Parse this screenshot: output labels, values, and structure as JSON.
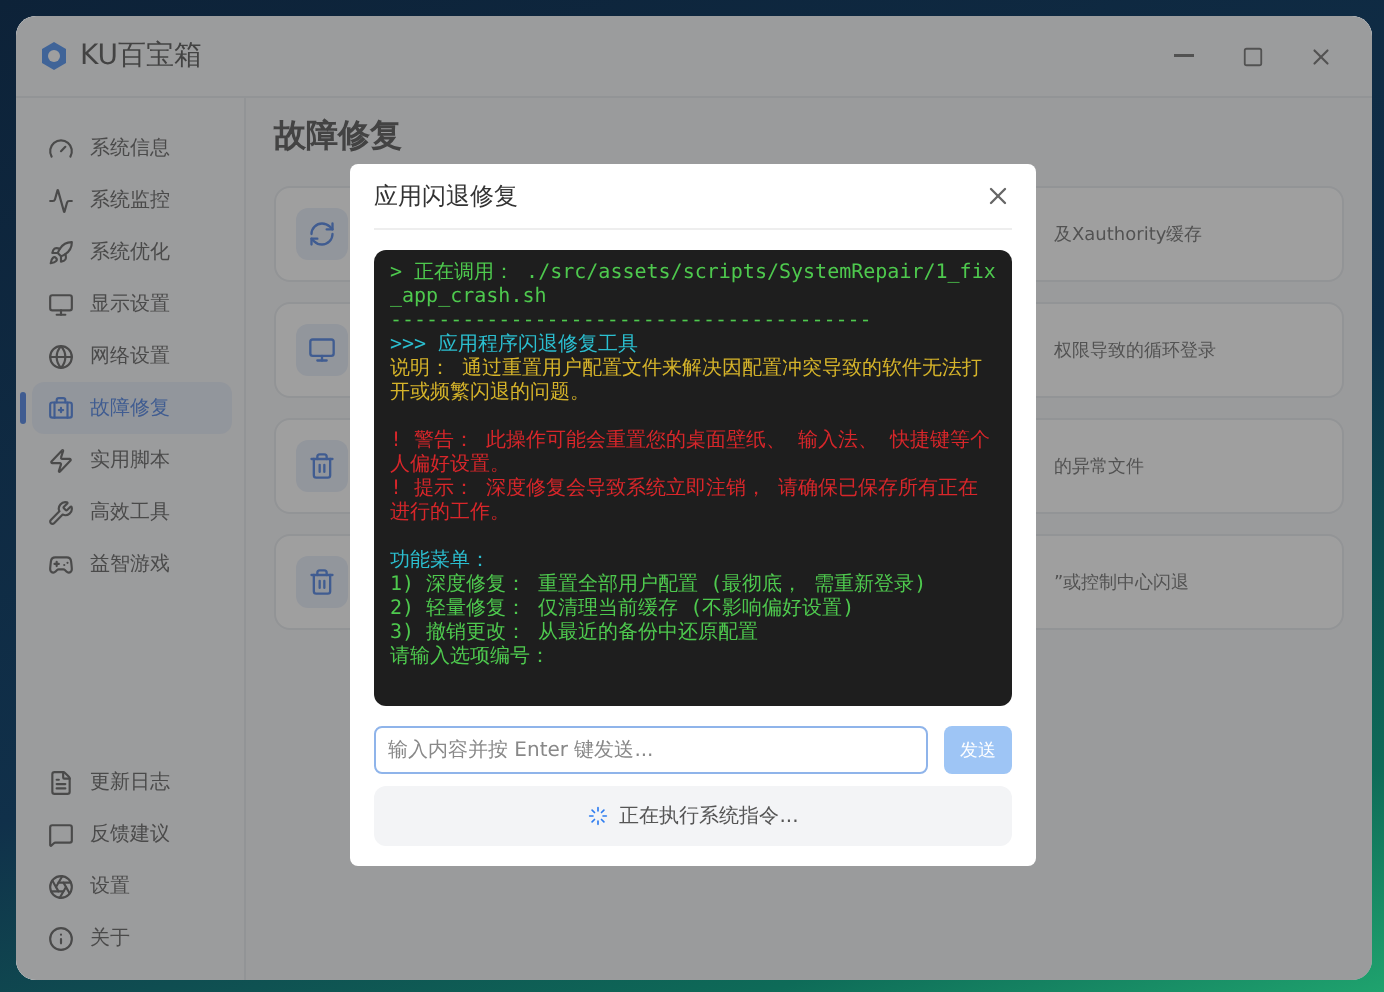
{
  "app": {
    "title": "KU百宝箱"
  },
  "sidebar": {
    "items": [
      {
        "label": "系统信息",
        "selected": false
      },
      {
        "label": "系统监控",
        "selected": false
      },
      {
        "label": "系统优化",
        "selected": false
      },
      {
        "label": "显示设置",
        "selected": false
      },
      {
        "label": "网络设置",
        "selected": false
      },
      {
        "label": "故障修复",
        "selected": true
      },
      {
        "label": "实用脚本",
        "selected": false
      },
      {
        "label": "高效工具",
        "selected": false
      },
      {
        "label": "益智游戏",
        "selected": false
      }
    ],
    "footer_items": [
      {
        "label": "更新日志"
      },
      {
        "label": "反馈建议"
      },
      {
        "label": "设置"
      },
      {
        "label": "关于"
      }
    ]
  },
  "page": {
    "title": "故障修复",
    "cards": [
      {
        "description": "及Xauthority缓存"
      },
      {
        "description": "权限导致的循环登录"
      },
      {
        "description": "的异常文件"
      },
      {
        "description": "”或控制中心闪退"
      }
    ]
  },
  "dialog": {
    "title": "应用闪退修复",
    "terminal": [
      {
        "kind": "command",
        "text": "> 正在调用： ./src/assets/scripts/SystemRepair/1_fix_app_crash.sh"
      },
      {
        "kind": "rule",
        "text": "----------------------------------------"
      },
      {
        "kind": "heading",
        "text": ">>> 应用程序闪退修复工具"
      },
      {
        "kind": "info",
        "text": "说明： 通过重置用户配置文件来解决因配置冲突导致的软件无法打开或频繁闪退的问题。"
      },
      {
        "kind": "blank"
      },
      {
        "kind": "warning",
        "text": "! 警告： 此操作可能会重置您的桌面壁纸、 输入法、 快捷键等个人偏好设置。"
      },
      {
        "kind": "warning",
        "text": "! 提示： 深度修复会导致系统立即注销， 请确保已保存所有正在进行的工作。"
      },
      {
        "kind": "blank"
      },
      {
        "kind": "heading",
        "text": "功能菜单："
      },
      {
        "kind": "option",
        "text": "1) 深度修复： 重置全部用户配置 (最彻底， 需重新登录)"
      },
      {
        "kind": "option",
        "text": "2) 轻量修复： 仅清理当前缓存 (不影响偏好设置)"
      },
      {
        "kind": "option",
        "text": "3) 撤销更改： 从最近的备份中还原配置"
      },
      {
        "kind": "option",
        "text": "请输入选项编号："
      }
    ],
    "input": {
      "placeholder": "输入内容并按 Enter 键发送..."
    },
    "send_button": {
      "label": "发送",
      "disabled": true
    },
    "status": "正在执行系统指令..."
  }
}
